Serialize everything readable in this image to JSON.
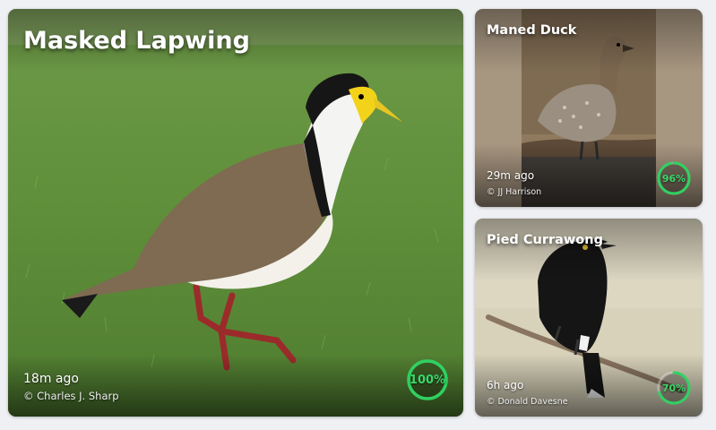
{
  "cards": {
    "main": {
      "title": "Masked Lapwing",
      "time": "18m ago",
      "credit": "© Charles J. Sharp",
      "confidence": 100,
      "confidence_label": "100%",
      "photo_icon": "masked-lapwing-photo"
    },
    "duck": {
      "title": "Maned Duck",
      "time": "29m ago",
      "credit": "© JJ Harrison",
      "confidence": 96,
      "confidence_label": "96%",
      "photo_icon": "maned-duck-photo"
    },
    "currawong": {
      "title": "Pied Currawong",
      "time": "6h ago",
      "credit": "© Donald Davesne",
      "confidence": 70,
      "confidence_label": "70%",
      "photo_icon": "pied-currawong-photo"
    }
  },
  "colors": {
    "ring_accent": "#2fd160",
    "ring_track": "#ffffff",
    "page_background": "#eef0f4"
  }
}
